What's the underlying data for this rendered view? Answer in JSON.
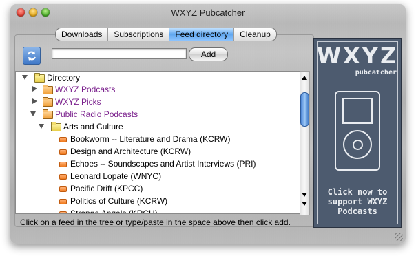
{
  "window": {
    "title": "WXYZ Pubcatcher"
  },
  "tabs": [
    {
      "label": "Downloads",
      "active": false
    },
    {
      "label": "Subscriptions",
      "active": false
    },
    {
      "label": "Feed directory",
      "active": true
    },
    {
      "label": "Cleanup",
      "active": false
    }
  ],
  "search": {
    "value": "",
    "add_label": "Add"
  },
  "tree": {
    "rows": [
      {
        "label": "Directory",
        "kind": "folder",
        "expanded": true
      },
      {
        "label": "WXYZ Podcasts",
        "kind": "folder-orange",
        "expanded": false
      },
      {
        "label": "WXYZ Picks",
        "kind": "folder-orange",
        "expanded": false
      },
      {
        "label": "Public Radio Podcasts",
        "kind": "folder-orange",
        "expanded": true
      },
      {
        "label": "Arts and Culture",
        "kind": "folder",
        "expanded": true
      },
      {
        "label": "Bookworm -- Literature and Drama (KCRW)",
        "kind": "feed"
      },
      {
        "label": "Design and Architecture (KCRW)",
        "kind": "feed"
      },
      {
        "label": "Echoes -- Soundscapes and Artist Interviews (PRI)",
        "kind": "feed"
      },
      {
        "label": "Leonard Lopate (WNYC)",
        "kind": "feed"
      },
      {
        "label": "Pacific Drift (KPCC)",
        "kind": "feed"
      },
      {
        "label": "Politics of Culture (KCRW)",
        "kind": "feed"
      },
      {
        "label": "Strange Angels (KRCH)",
        "kind": "feed"
      }
    ]
  },
  "status": {
    "text": "Click on a feed in the tree or type/paste in the space above then click add."
  },
  "ad": {
    "logo": "WXYZ",
    "subtitle": "pubcatcher",
    "cta_line1": "Click now to",
    "cta_line2": "support WXYZ",
    "cta_line3": "Podcasts"
  },
  "colors": {
    "accent": "#5fa6ef",
    "purple_text": "#7a1f8c",
    "ad_bg": "#4d5b6f",
    "feed_icon": "#f07a1c"
  }
}
